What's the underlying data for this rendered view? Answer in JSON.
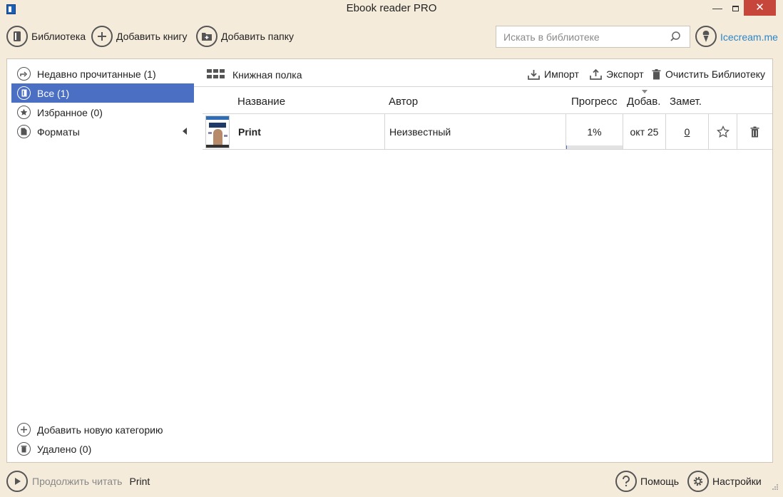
{
  "window": {
    "title": "Ebook reader PRO",
    "minimize_glyph": "—",
    "close_glyph": "✕"
  },
  "toolbar": {
    "library_label": "Библиотека",
    "add_book_label": "Добавить книгу",
    "add_folder_label": "Добавить папку",
    "search_placeholder": "Искать в библиотеке",
    "brand_link": "Icecream.me"
  },
  "sidebar": {
    "items": [
      {
        "label": "Недавно прочитанные (1)",
        "icon": "recent-icon"
      },
      {
        "label": "Все (1)",
        "icon": "book-icon",
        "active": true
      },
      {
        "label": "Избранное (0)",
        "icon": "star-icon"
      },
      {
        "label": "Форматы",
        "icon": "file-icon",
        "expandable": true
      }
    ],
    "add_category_label": "Добавить новую категорию",
    "deleted_label": "Удалено (0)"
  },
  "shelf": {
    "view_label": "Книжная полка",
    "import_label": "Импорт",
    "export_label": "Экспорт",
    "clear_label": "Очистить Библиотеку"
  },
  "table": {
    "columns": {
      "title": "Название",
      "author": "Автор",
      "progress": "Прогресс",
      "added": "Добав.",
      "notes": "Замет."
    },
    "rows": [
      {
        "title": "Print",
        "author": "Неизвестный",
        "progress": "1%",
        "progress_fraction": 0.01,
        "added": "окт 25",
        "notes": "0"
      }
    ]
  },
  "bottom": {
    "continue_label": "Продолжить читать",
    "continue_book": "Print",
    "help_label": "Помощь",
    "settings_label": "Настройки"
  },
  "colors": {
    "background": "#f5ebdb",
    "accent": "#4a6fc3",
    "close": "#c7463c",
    "link": "#2a86c9"
  }
}
